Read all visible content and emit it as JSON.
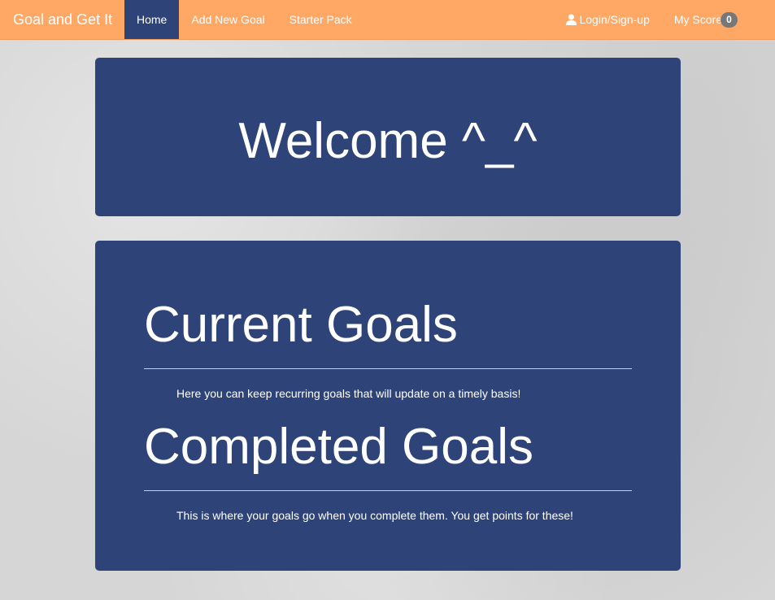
{
  "navbar": {
    "brand": "Goal and Get It",
    "items": [
      {
        "label": "Home",
        "active": true
      },
      {
        "label": "Add New Goal",
        "active": false
      },
      {
        "label": "Starter Pack",
        "active": false
      }
    ],
    "login_label": "Login/Sign-up",
    "login_icon": "user-icon",
    "score_label": "My Score",
    "score_value": "0"
  },
  "welcome": {
    "title": "Welcome ^_^"
  },
  "goals": {
    "current": {
      "title": "Current Goals",
      "description": "Here you can keep recurring goals that will update on a timely basis!"
    },
    "completed": {
      "title": "Completed Goals",
      "description": "This is where your goals go when you complete them. You get points for these!"
    }
  },
  "colors": {
    "navbar": "#ffa866",
    "panel": "#2e4377",
    "badge": "#777777",
    "text": "#ffffff"
  }
}
